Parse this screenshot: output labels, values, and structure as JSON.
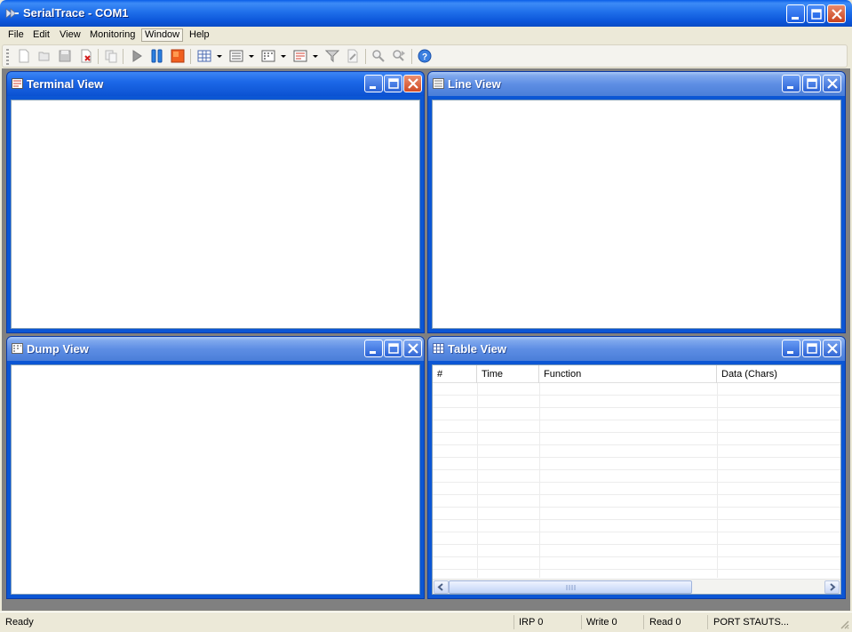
{
  "window": {
    "title": "SerialTrace - COM1",
    "buttons": {
      "minimize": "minimize",
      "maximize": "maximize",
      "close": "close"
    }
  },
  "menu": {
    "items": [
      "File",
      "Edit",
      "View",
      "Monitoring",
      "Window",
      "Help"
    ]
  },
  "toolbar": {
    "icons": [
      "new-icon",
      "open-icon",
      "save-icon",
      "close-file-icon",
      "copy-icon",
      "start-icon",
      "pause-icon",
      "stop-icon",
      "grid-icon",
      "list-icon",
      "dump-icon",
      "table-icon",
      "filter-icon",
      "clear-icon",
      "find-icon",
      "find-next-icon",
      "help-icon"
    ]
  },
  "children": {
    "terminal": {
      "title": "Terminal View"
    },
    "line": {
      "title": "Line View"
    },
    "dump": {
      "title": "Dump View"
    },
    "table": {
      "title": "Table View",
      "columns": [
        "#",
        "Time",
        "Function",
        "Data (Chars)"
      ],
      "rows": 16
    }
  },
  "status": {
    "ready": "Ready",
    "irp": "IRP 0",
    "write": "Write 0",
    "read": "Read 0",
    "port": "PORT STAUTS..."
  },
  "colors": {
    "titlebar": "#0b55d9",
    "child_active_caption": "#1c68e8",
    "child_inactive_caption": "#7fa8ed",
    "mdi_background": "#808080",
    "chrome": "#ece9d8"
  }
}
